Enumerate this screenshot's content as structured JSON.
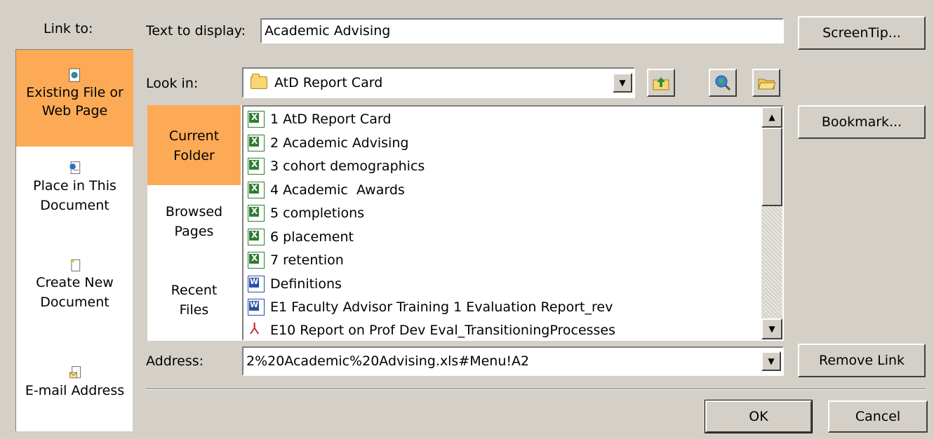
{
  "dialog": {
    "link_to_label": "Link to:",
    "text_to_display_label": "Text to display:",
    "text_to_display_value": "Academic Advising",
    "screentip_label": "ScreenTip...",
    "look_in_label": "Look in:",
    "look_in_value": "AtD Report Card",
    "bookmark_label": "Bookmark...",
    "address_label": "Address:",
    "address_value": "2%20Academic%20Advising.xls#Menu!A2",
    "remove_link_label": "Remove Link",
    "ok_label": "OK",
    "cancel_label": "Cancel"
  },
  "link_types": [
    {
      "line1": "Existing File or",
      "line2": "Web Page",
      "icon": "web-page-icon",
      "selected": true
    },
    {
      "line1": "Place in This",
      "line2": "Document",
      "icon": "document-place-icon",
      "selected": false
    },
    {
      "line1": "Create New",
      "line2": "Document",
      "icon": "new-document-icon",
      "selected": false
    },
    {
      "line1": "E-mail Address",
      "line2": "",
      "icon": "email-icon",
      "selected": false
    }
  ],
  "tabs": [
    {
      "line1": "Current",
      "line2": "Folder",
      "selected": true
    },
    {
      "line1": "Browsed",
      "line2": "Pages",
      "selected": false
    },
    {
      "line1": "Recent",
      "line2": "Files",
      "selected": false
    }
  ],
  "files": [
    {
      "name": "1 AtD Report Card",
      "type": "xls"
    },
    {
      "name": "2 Academic Advising",
      "type": "xls"
    },
    {
      "name": "3 cohort demographics",
      "type": "xls"
    },
    {
      "name": "4 Academic  Awards",
      "type": "xls"
    },
    {
      "name": "5 completions",
      "type": "xls"
    },
    {
      "name": "6 placement",
      "type": "xls"
    },
    {
      "name": "7 retention",
      "type": "xls"
    },
    {
      "name": "Definitions",
      "type": "doc"
    },
    {
      "name": "E1 Faculty Advisor Training 1 Evaluation Report_rev",
      "type": "doc"
    },
    {
      "name": "E10 Report on Prof Dev Eval_TransitioningProcesses",
      "type": "pdf"
    }
  ],
  "icons": {
    "folder": "folder-icon",
    "up_folder": "up-one-folder-icon",
    "browse_web": "browse-web-icon",
    "browse_file": "browse-file-icon"
  }
}
